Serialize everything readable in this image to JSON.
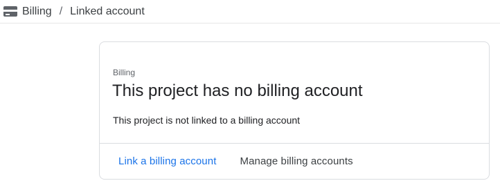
{
  "breadcrumb": {
    "icon": "billing-card-icon",
    "root_label": "Billing",
    "separator": "/",
    "current_label": "Linked account"
  },
  "card": {
    "eyebrow": "Billing",
    "title": "This project has no billing account",
    "description": "This project is not linked to a billing account",
    "actions": {
      "link_label": "Link a billing account",
      "manage_label": "Manage billing accounts"
    }
  },
  "colors": {
    "primary_link": "#1a73e8",
    "text": "#202124",
    "secondary_text": "#5f6368",
    "border": "#dadce0"
  }
}
